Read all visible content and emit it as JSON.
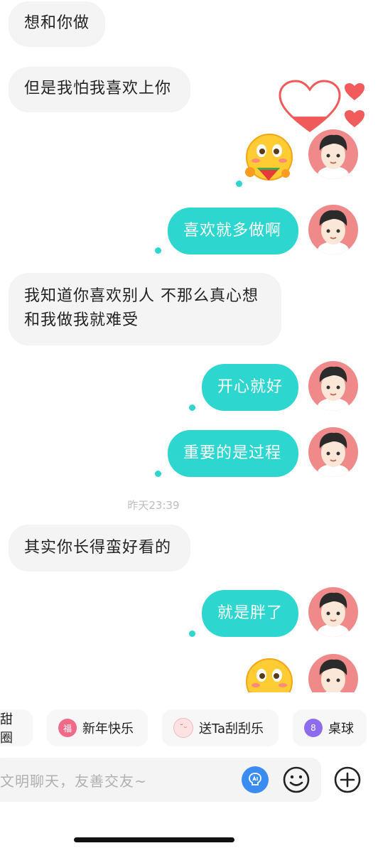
{
  "messages": [
    {
      "side": "in",
      "text": "想和你做"
    },
    {
      "side": "in",
      "text": "但是我怕我喜欢上你"
    },
    {
      "side": "out",
      "emoji": "flushed-watermelon"
    },
    {
      "side": "out",
      "text": "喜欢就多做啊"
    },
    {
      "side": "in",
      "text1": "我知道你喜欢别人 不那么真心想",
      "text2": "和我做我就难受"
    },
    {
      "side": "out",
      "text": "开心就好"
    },
    {
      "side": "out",
      "text": "重要的是过程"
    },
    {
      "side": "in",
      "text": "其实你长得蛮好看的"
    },
    {
      "side": "out",
      "text": "就是胖了"
    },
    {
      "side": "out",
      "emoji": "flushed-watermelon"
    }
  ],
  "timestamp": "昨天23:39",
  "quick_replies": [
    {
      "label": "甜圈",
      "icon": "donut-icon"
    },
    {
      "label": "新年快乐",
      "icon": "fu-icon"
    },
    {
      "label": "送Ta刮刮乐",
      "icon": "scratch-icon"
    },
    {
      "label": "桌球",
      "icon": "billiard-icon"
    }
  ],
  "input": {
    "placeholder": "文明聊天，友善交友~"
  },
  "colors": {
    "accent": "#2ed6d0",
    "avatar_bg": "#f08a8a",
    "bubble_in": "#f4f4f4"
  }
}
